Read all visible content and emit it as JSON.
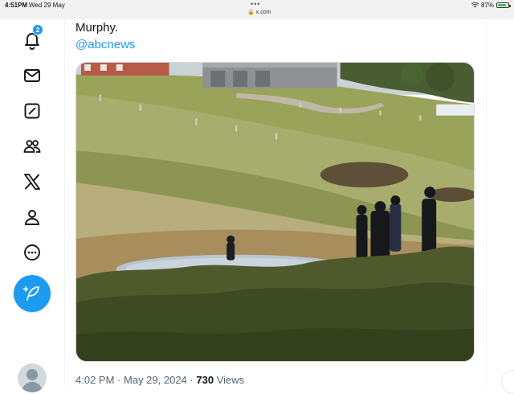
{
  "status_bar": {
    "time": "4:51PM",
    "date": "Wed 29 May",
    "url": "x.com",
    "battery": "87%",
    "battery_level": 0.87
  },
  "sidebar": {
    "notifications_badge": "2",
    "items": [
      {
        "icon": "bell-icon"
      },
      {
        "icon": "mail-icon"
      },
      {
        "icon": "grok-icon"
      },
      {
        "icon": "communities-icon"
      },
      {
        "icon": "x-logo-icon"
      },
      {
        "icon": "profile-icon"
      },
      {
        "icon": "more-icon"
      }
    ],
    "compose_icon": "feather-plus-icon"
  },
  "tweet": {
    "text": "Murphy.",
    "handle": "@abcnews",
    "photo_alt": "",
    "time": "4:02 PM",
    "separator": "·",
    "date": "May 29, 2024",
    "views_count": "730",
    "views_label": "Views"
  },
  "colors": {
    "accent": "#1d9bf0",
    "text": "#0f1419",
    "muted": "#536471",
    "battery_green": "#34c759"
  }
}
